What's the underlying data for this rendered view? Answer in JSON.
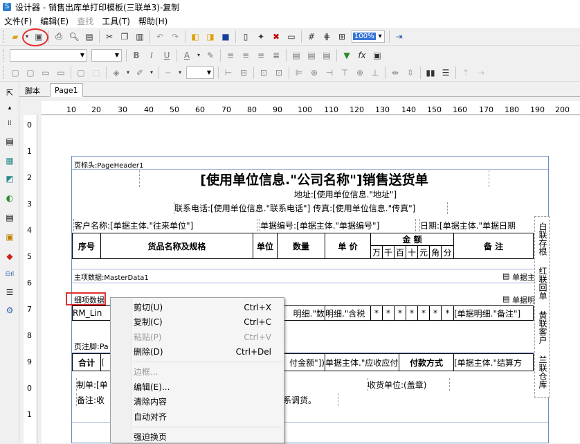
{
  "window": {
    "title": "设计器 - 销售出库单打印模板(三联单3)-复制"
  },
  "menu": [
    "文件(F)",
    "编辑(E)",
    "查找",
    "工具(T)",
    "帮助(H)"
  ],
  "toolbar3": {
    "zoom": "100%"
  },
  "tabs": [
    "脚本",
    "Page1"
  ],
  "ruler": {
    "h": [
      "0",
      "10",
      "20",
      "30",
      "40",
      "50",
      "60",
      "70",
      "80",
      "90",
      "100",
      "110",
      "120",
      "130",
      "140",
      "150",
      "160",
      "170",
      "180",
      "190",
      "200"
    ],
    "v": [
      "0",
      "1",
      "2",
      "3",
      "4",
      "5",
      "6",
      "7",
      "8",
      "9",
      "0",
      "1"
    ]
  },
  "report": {
    "page_header_label": "页标头:PageHeader1",
    "title": "[使用单位信息.\"公司名称\"]销售送货单",
    "address": "地址:[使用单位信息.\"地址\"]",
    "contact": "联系电话:[使用单位信息.\"联系电话\"]  传真:[使用单位信息.\"传真\"]",
    "customer": "客户名称:[单据主体.\"往来单位\"]",
    "doc_no": "单据编号:[单据主体.\"单据编号\"]",
    "date": "日期:[单据主体.\"单据日期",
    "col_no": "序号",
    "col_name": "货品名称及规格",
    "col_unit": "单位",
    "col_qty": "数量",
    "col_price": "单  价",
    "col_amount": "金  额",
    "amount_digits": [
      "万",
      "千",
      "百",
      "十",
      "元",
      "角",
      "分"
    ],
    "col_remark": "备  注",
    "master_label": "主项数据:MasterData1",
    "master_right": "单据主",
    "detail_label": "细项数据",
    "detail_right": "单据明",
    "detail_row_left": "RM_Lin",
    "detail_row_mid1": "明细.\"数",
    "detail_row_mid2": "明细.\"含税",
    "detail_stars": [
      "*",
      "*",
      "*",
      "*",
      "*",
      "*",
      "*"
    ],
    "detail_row_remark": "[单据明细.\"备注\"]",
    "footer_label": "页注脚:Pa",
    "total": "合计",
    "total_open": "(",
    "total_amount": "付金额\"])",
    "receivable": "单据主体.\"应收应付",
    "pay_method": "付款方式",
    "settle": "[单据主体.\"结算方",
    "maker": "制单:[单",
    "receiver": "收货单位:(盖章)",
    "remark": "备注:收",
    "remark_tail": "系调货。",
    "side_labels": [
      "白联存根",
      "红联回单",
      "黄联客户",
      "兰联仓库"
    ]
  },
  "context_menu": {
    "items": [
      {
        "label": "剪切(U)",
        "key": "Ctrl+X",
        "enabled": true
      },
      {
        "label": "复制(C)",
        "key": "Ctrl+C",
        "enabled": true
      },
      {
        "label": "粘贴(P)",
        "key": "Ctrl+V",
        "enabled": false
      },
      {
        "label": "删除(D)",
        "key": "Ctrl+Del",
        "enabled": true
      },
      {
        "label": "边框...",
        "key": "",
        "enabled": false
      },
      {
        "label": "编辑(E)...",
        "key": "",
        "enabled": true
      },
      {
        "label": "清除内容",
        "key": "",
        "enabled": true
      },
      {
        "label": "自动对齐",
        "key": "",
        "enabled": true
      },
      {
        "label": "强迫换页",
        "key": "",
        "enabled": true
      }
    ]
  }
}
